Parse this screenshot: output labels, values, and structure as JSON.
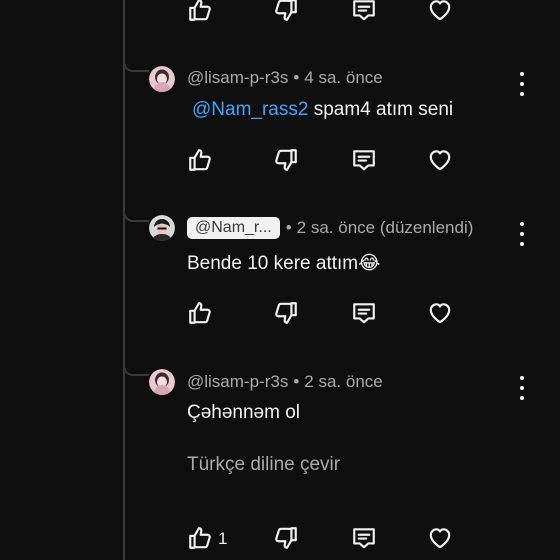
{
  "comments": [
    {
      "author": "@lisam-p-r3s",
      "time": "4 sa. önce",
      "mention": "@Nam_rass2",
      "text": " spam4 atım seni"
    },
    {
      "author_chip": "@Nam_r...",
      "time": "2 sa. önce (düzenlendi)",
      "text": "Bende 10 kere attım😂"
    },
    {
      "author": "@lisam-p-r3s",
      "time": "2 sa. önce",
      "text": "Çəhənnəm ol",
      "translate": "Türkçe diline çevir",
      "like_count": "1"
    }
  ],
  "separator": "•",
  "icons": {
    "like": "thumbs-up-icon",
    "dislike": "thumbs-down-icon",
    "reply": "reply-comment-icon",
    "heart": "heart-icon",
    "more": "more-vertical-icon"
  },
  "colors": {
    "mention": "#3ea6ff",
    "background": "#0f0f0f"
  }
}
